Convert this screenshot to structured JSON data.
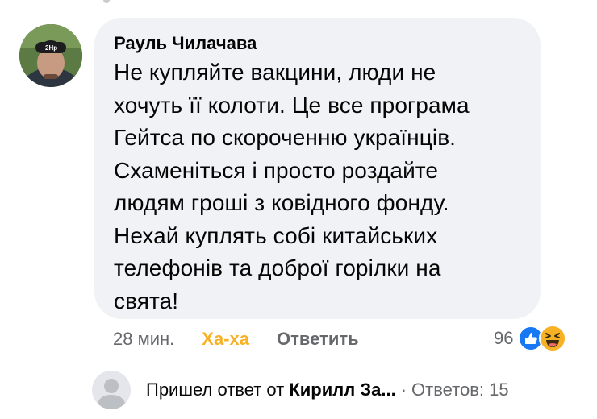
{
  "comment": {
    "author": "Рауль Чилачава",
    "text": "Не купляйте вакцини, люди не\nхочуть її колоти. Це все програма\nГейтса по скороченню українців.\nСхаменіться і просто роздайте\nлюдям гроші з ковідного фонду.\nНехай куплять собі китайських\nтелефонів та доброї горілки на\nсвята!",
    "avatar_icon": "user-avatar-photo",
    "cap_text": "2Hp"
  },
  "meta": {
    "time": "28 мин.",
    "reaction_label": "Ха-ха",
    "reply_label": "Ответить",
    "reaction_count": "96",
    "reaction_icons": [
      "like-icon",
      "haha-icon"
    ]
  },
  "replies": {
    "prefix": "Пришел ответ от",
    "name": "Кирилл За...",
    "separator": "·",
    "count_label": "Ответов: 15",
    "avatar_icon": "default-profile-icon"
  },
  "colors": {
    "bubble": "#f0f2f5",
    "haha": "#f7b125",
    "muted": "#65676b",
    "like": "#1877f2"
  }
}
